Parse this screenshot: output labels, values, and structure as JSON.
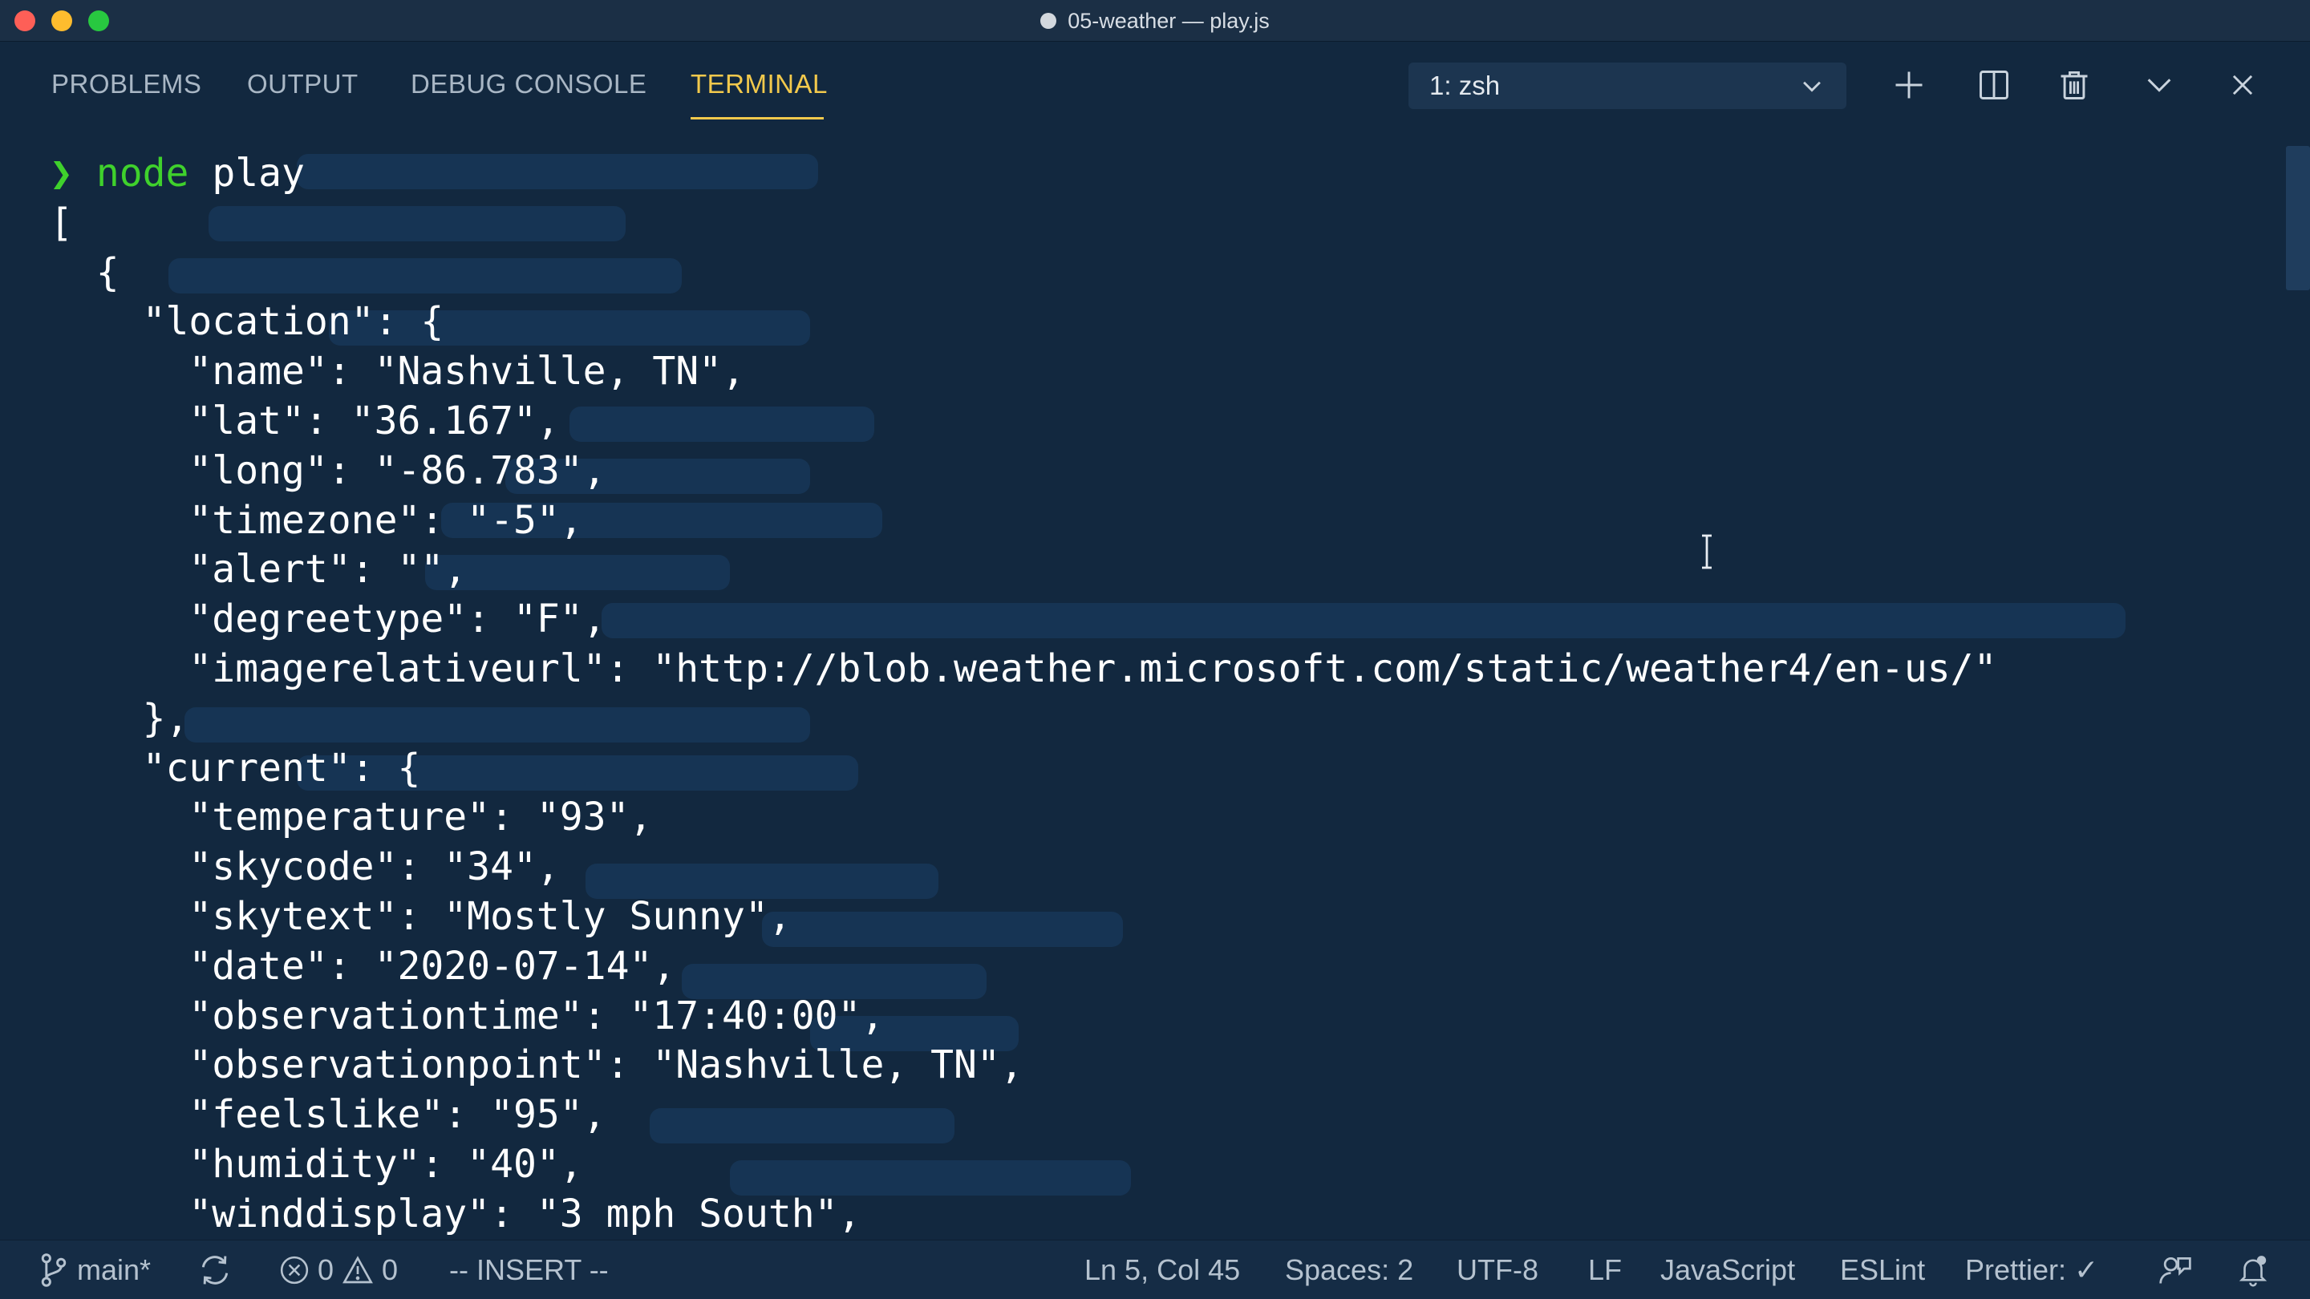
{
  "window": {
    "title": "05-weather — play.js"
  },
  "panel": {
    "tabs": [
      {
        "label": "PROBLEMS"
      },
      {
        "label": "OUTPUT"
      },
      {
        "label": "DEBUG CONSOLE"
      },
      {
        "label": "TERMINAL",
        "active": true
      }
    ],
    "terminal_selector": "1: zsh"
  },
  "terminal": {
    "prompt_symbol": "❯",
    "command": "node",
    "argument": "play",
    "output_lines": [
      "[",
      "  {",
      "    \"location\": {",
      "      \"name\": \"Nashville, TN\",",
      "      \"lat\": \"36.167\",",
      "      \"long\": \"-86.783\",",
      "      \"timezone\": \"-5\",",
      "      \"alert\": \"\",",
      "      \"degreetype\": \"F\",",
      "      \"imagerelativeurl\": \"http://blob.weather.microsoft.com/static/weather4/en-us/\"",
      "    },",
      "    \"current\": {",
      "      \"temperature\": \"93\",",
      "      \"skycode\": \"34\",",
      "      \"skytext\": \"Mostly Sunny\",",
      "      \"date\": \"2020-07-14\",",
      "      \"observationtime\": \"17:40:00\",",
      "      \"observationpoint\": \"Nashville, TN\",",
      "      \"feelslike\": \"95\",",
      "      \"humidity\": \"40\",",
      "      \"winddisplay\": \"3 mph South\","
    ]
  },
  "statusbar": {
    "branch": "main*",
    "errors": "0",
    "warnings": "0",
    "mode": "-- INSERT --",
    "cursor_position": "Ln 5, Col 45",
    "indentation": "Spaces: 2",
    "encoding": "UTF-8",
    "line_ending": "LF",
    "language": "JavaScript",
    "linter": "ESLint",
    "formatter": "Prettier: ✓"
  },
  "colors": {
    "background": "#12283f",
    "active_tab": "#f2c94c",
    "prompt": "#3fd12c",
    "text": "#ffffff"
  }
}
